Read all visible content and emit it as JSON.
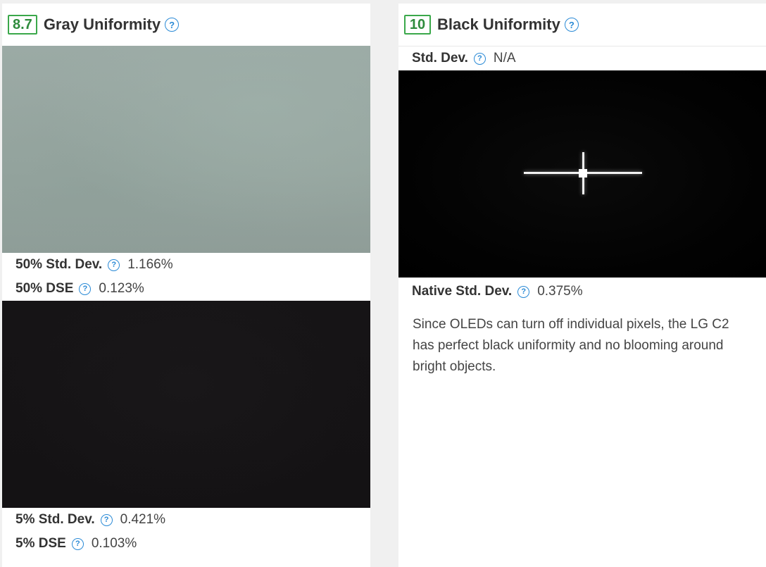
{
  "gray_uniformity": {
    "score": "8.7",
    "title": "Gray Uniformity",
    "metrics": [
      {
        "label": "50% Std. Dev.",
        "value": "1.166%"
      },
      {
        "label": "50% DSE",
        "value": "0.123%"
      },
      {
        "label": "5% Std. Dev.",
        "value": "0.421%"
      },
      {
        "label": "5% DSE",
        "value": "0.103%"
      }
    ]
  },
  "black_uniformity": {
    "score": "10",
    "title": "Black Uniformity",
    "std_dev": {
      "label": "Std. Dev.",
      "value": "N/A"
    },
    "native_std_dev": {
      "label": "Native Std. Dev.",
      "value": "0.375%"
    },
    "description": "Since OLEDs can turn off individual pixels, the LG C2 has perfect black uniformity and no blooming around bright objects."
  },
  "icons": {
    "help": "question-circle-icon",
    "help_glyph": "?"
  },
  "colors": {
    "score_border": "#3aa84a",
    "score_text": "#2e8b3c",
    "help_icon": "#2a8ad6"
  }
}
